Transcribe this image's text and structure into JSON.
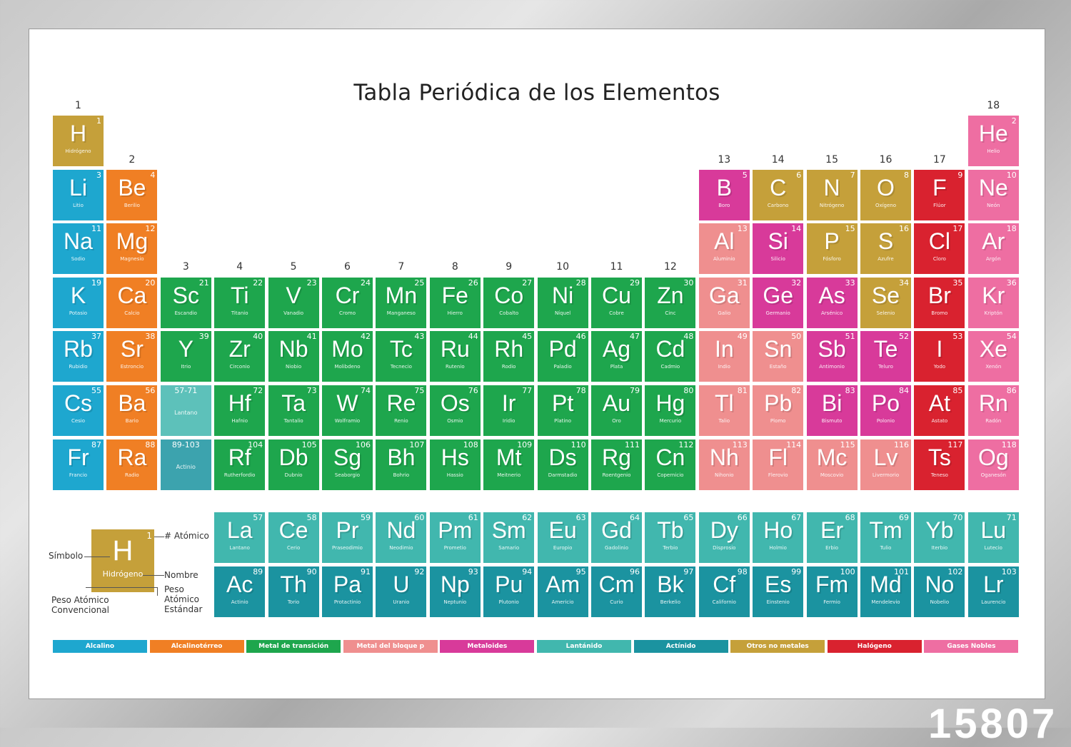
{
  "title": "Tabla Periódica de los Elementos",
  "colors": {
    "alkali": "#1ea7cf",
    "alkaline": "#f07f24",
    "transition": "#1ea64d",
    "post": "#ef8f8f",
    "metalloid": "#d83a9a",
    "lanthanide": "#41b7ae",
    "actinide": "#1b93a0",
    "nonmetal": "#c5a03a",
    "halogen": "#d9222f",
    "noble": "#ee6ea2"
  },
  "group_numbers": [
    "1",
    "2",
    "3",
    "4",
    "5",
    "6",
    "7",
    "8",
    "9",
    "10",
    "11",
    "12",
    "13",
    "14",
    "15",
    "16",
    "17",
    "18"
  ],
  "elements": [
    {
      "n": "1",
      "s": "H",
      "name": "Hidrógeno",
      "c": "nonmetal",
      "g": 1,
      "p": 1
    },
    {
      "n": "2",
      "s": "He",
      "name": "Helio",
      "c": "noble",
      "g": 18,
      "p": 1
    },
    {
      "n": "3",
      "s": "Li",
      "name": "Litio",
      "c": "alkali",
      "g": 1,
      "p": 2
    },
    {
      "n": "4",
      "s": "Be",
      "name": "Berilio",
      "c": "alkaline",
      "g": 2,
      "p": 2
    },
    {
      "n": "5",
      "s": "B",
      "name": "Boro",
      "c": "metalloid",
      "g": 13,
      "p": 2
    },
    {
      "n": "6",
      "s": "C",
      "name": "Carbono",
      "c": "nonmetal",
      "g": 14,
      "p": 2
    },
    {
      "n": "7",
      "s": "N",
      "name": "Nitrógeno",
      "c": "nonmetal",
      "g": 15,
      "p": 2
    },
    {
      "n": "8",
      "s": "O",
      "name": "Oxígeno",
      "c": "nonmetal",
      "g": 16,
      "p": 2
    },
    {
      "n": "9",
      "s": "F",
      "name": "Flúor",
      "c": "halogen",
      "g": 17,
      "p": 2
    },
    {
      "n": "10",
      "s": "Ne",
      "name": "Neón",
      "c": "noble",
      "g": 18,
      "p": 2
    },
    {
      "n": "11",
      "s": "Na",
      "name": "Sodio",
      "c": "alkali",
      "g": 1,
      "p": 3
    },
    {
      "n": "12",
      "s": "Mg",
      "name": "Magnesio",
      "c": "alkaline",
      "g": 2,
      "p": 3
    },
    {
      "n": "13",
      "s": "Al",
      "name": "Aluminio",
      "c": "post",
      "g": 13,
      "p": 3
    },
    {
      "n": "14",
      "s": "Si",
      "name": "Silicio",
      "c": "metalloid",
      "g": 14,
      "p": 3
    },
    {
      "n": "15",
      "s": "P",
      "name": "Fósforo",
      "c": "nonmetal",
      "g": 15,
      "p": 3
    },
    {
      "n": "16",
      "s": "S",
      "name": "Azufre",
      "c": "nonmetal",
      "g": 16,
      "p": 3
    },
    {
      "n": "17",
      "s": "Cl",
      "name": "Cloro",
      "c": "halogen",
      "g": 17,
      "p": 3
    },
    {
      "n": "18",
      "s": "Ar",
      "name": "Argón",
      "c": "noble",
      "g": 18,
      "p": 3
    },
    {
      "n": "19",
      "s": "K",
      "name": "Potasio",
      "c": "alkali",
      "g": 1,
      "p": 4
    },
    {
      "n": "20",
      "s": "Ca",
      "name": "Calcio",
      "c": "alkaline",
      "g": 2,
      "p": 4
    },
    {
      "n": "21",
      "s": "Sc",
      "name": "Escandio",
      "c": "transition",
      "g": 3,
      "p": 4
    },
    {
      "n": "22",
      "s": "Ti",
      "name": "Titanio",
      "c": "transition",
      "g": 4,
      "p": 4
    },
    {
      "n": "23",
      "s": "V",
      "name": "Vanadio",
      "c": "transition",
      "g": 5,
      "p": 4
    },
    {
      "n": "24",
      "s": "Cr",
      "name": "Cromo",
      "c": "transition",
      "g": 6,
      "p": 4
    },
    {
      "n": "25",
      "s": "Mn",
      "name": "Manganeso",
      "c": "transition",
      "g": 7,
      "p": 4
    },
    {
      "n": "26",
      "s": "Fe",
      "name": "Hierro",
      "c": "transition",
      "g": 8,
      "p": 4
    },
    {
      "n": "27",
      "s": "Co",
      "name": "Cobalto",
      "c": "transition",
      "g": 9,
      "p": 4
    },
    {
      "n": "28",
      "s": "Ni",
      "name": "Níquel",
      "c": "transition",
      "g": 10,
      "p": 4
    },
    {
      "n": "29",
      "s": "Cu",
      "name": "Cobre",
      "c": "transition",
      "g": 11,
      "p": 4
    },
    {
      "n": "30",
      "s": "Zn",
      "name": "Cinc",
      "c": "transition",
      "g": 12,
      "p": 4
    },
    {
      "n": "31",
      "s": "Ga",
      "name": "Galio",
      "c": "post",
      "g": 13,
      "p": 4
    },
    {
      "n": "32",
      "s": "Ge",
      "name": "Germanio",
      "c": "metalloid",
      "g": 14,
      "p": 4
    },
    {
      "n": "33",
      "s": "As",
      "name": "Arsénico",
      "c": "metalloid",
      "g": 15,
      "p": 4
    },
    {
      "n": "34",
      "s": "Se",
      "name": "Selenio",
      "c": "nonmetal",
      "g": 16,
      "p": 4
    },
    {
      "n": "35",
      "s": "Br",
      "name": "Bromo",
      "c": "halogen",
      "g": 17,
      "p": 4
    },
    {
      "n": "36",
      "s": "Kr",
      "name": "Kriptón",
      "c": "noble",
      "g": 18,
      "p": 4
    },
    {
      "n": "37",
      "s": "Rb",
      "name": "Rubidio",
      "c": "alkali",
      "g": 1,
      "p": 5
    },
    {
      "n": "38",
      "s": "Sr",
      "name": "Estroncio",
      "c": "alkaline",
      "g": 2,
      "p": 5
    },
    {
      "n": "39",
      "s": "Y",
      "name": "Itrio",
      "c": "transition",
      "g": 3,
      "p": 5
    },
    {
      "n": "40",
      "s": "Zr",
      "name": "Circonio",
      "c": "transition",
      "g": 4,
      "p": 5
    },
    {
      "n": "41",
      "s": "Nb",
      "name": "Niobio",
      "c": "transition",
      "g": 5,
      "p": 5
    },
    {
      "n": "42",
      "s": "Mo",
      "name": "Molibdeno",
      "c": "transition",
      "g": 6,
      "p": 5
    },
    {
      "n": "43",
      "s": "Tc",
      "name": "Tecnecio",
      "c": "transition",
      "g": 7,
      "p": 5
    },
    {
      "n": "44",
      "s": "Ru",
      "name": "Rutenio",
      "c": "transition",
      "g": 8,
      "p": 5
    },
    {
      "n": "45",
      "s": "Rh",
      "name": "Rodio",
      "c": "transition",
      "g": 9,
      "p": 5
    },
    {
      "n": "46",
      "s": "Pd",
      "name": "Paladio",
      "c": "transition",
      "g": 10,
      "p": 5
    },
    {
      "n": "47",
      "s": "Ag",
      "name": "Plata",
      "c": "transition",
      "g": 11,
      "p": 5
    },
    {
      "n": "48",
      "s": "Cd",
      "name": "Cadmio",
      "c": "transition",
      "g": 12,
      "p": 5
    },
    {
      "n": "49",
      "s": "In",
      "name": "Indio",
      "c": "post",
      "g": 13,
      "p": 5
    },
    {
      "n": "50",
      "s": "Sn",
      "name": "Estaño",
      "c": "post",
      "g": 14,
      "p": 5
    },
    {
      "n": "51",
      "s": "Sb",
      "name": "Antimonio",
      "c": "metalloid",
      "g": 15,
      "p": 5
    },
    {
      "n": "52",
      "s": "Te",
      "name": "Teluro",
      "c": "metalloid",
      "g": 16,
      "p": 5
    },
    {
      "n": "53",
      "s": "I",
      "name": "Yodo",
      "c": "halogen",
      "g": 17,
      "p": 5
    },
    {
      "n": "54",
      "s": "Xe",
      "name": "Xenón",
      "c": "noble",
      "g": 18,
      "p": 5
    },
    {
      "n": "55",
      "s": "Cs",
      "name": "Cesio",
      "c": "alkali",
      "g": 1,
      "p": 6
    },
    {
      "n": "56",
      "s": "Ba",
      "name": "Bario",
      "c": "alkaline",
      "g": 2,
      "p": 6
    },
    {
      "n": "57-71",
      "s": "",
      "name": "Lantano",
      "c": "lanthanide",
      "g": 3,
      "p": 6,
      "placeholder": true
    },
    {
      "n": "72",
      "s": "Hf",
      "name": "Hafnio",
      "c": "transition",
      "g": 4,
      "p": 6
    },
    {
      "n": "73",
      "s": "Ta",
      "name": "Tantalio",
      "c": "transition",
      "g": 5,
      "p": 6
    },
    {
      "n": "74",
      "s": "W",
      "name": "Wolframio",
      "c": "transition",
      "g": 6,
      "p": 6
    },
    {
      "n": "75",
      "s": "Re",
      "name": "Renio",
      "c": "transition",
      "g": 7,
      "p": 6
    },
    {
      "n": "76",
      "s": "Os",
      "name": "Osmio",
      "c": "transition",
      "g": 8,
      "p": 6
    },
    {
      "n": "77",
      "s": "Ir",
      "name": "Iridio",
      "c": "transition",
      "g": 9,
      "p": 6
    },
    {
      "n": "78",
      "s": "Pt",
      "name": "Platino",
      "c": "transition",
      "g": 10,
      "p": 6
    },
    {
      "n": "79",
      "s": "Au",
      "name": "Oro",
      "c": "transition",
      "g": 11,
      "p": 6
    },
    {
      "n": "80",
      "s": "Hg",
      "name": "Mercurio",
      "c": "transition",
      "g": 12,
      "p": 6
    },
    {
      "n": "81",
      "s": "Tl",
      "name": "Talio",
      "c": "post",
      "g": 13,
      "p": 6
    },
    {
      "n": "82",
      "s": "Pb",
      "name": "Plomo",
      "c": "post",
      "g": 14,
      "p": 6
    },
    {
      "n": "83",
      "s": "Bi",
      "name": "Bismuto",
      "c": "metalloid",
      "g": 15,
      "p": 6
    },
    {
      "n": "84",
      "s": "Po",
      "name": "Polonio",
      "c": "metalloid",
      "g": 16,
      "p": 6
    },
    {
      "n": "85",
      "s": "At",
      "name": "Astato",
      "c": "halogen",
      "g": 17,
      "p": 6
    },
    {
      "n": "86",
      "s": "Rn",
      "name": "Radón",
      "c": "noble",
      "g": 18,
      "p": 6
    },
    {
      "n": "87",
      "s": "Fr",
      "name": "Francio",
      "c": "alkali",
      "g": 1,
      "p": 7
    },
    {
      "n": "88",
      "s": "Ra",
      "name": "Radio",
      "c": "alkaline",
      "g": 2,
      "p": 7
    },
    {
      "n": "89-103",
      "s": "",
      "name": "Actinio",
      "c": "actinide",
      "g": 3,
      "p": 7,
      "placeholder": true
    },
    {
      "n": "104",
      "s": "Rf",
      "name": "Rutherfordio",
      "c": "transition",
      "g": 4,
      "p": 7
    },
    {
      "n": "105",
      "s": "Db",
      "name": "Dubnio",
      "c": "transition",
      "g": 5,
      "p": 7
    },
    {
      "n": "106",
      "s": "Sg",
      "name": "Seaborgio",
      "c": "transition",
      "g": 6,
      "p": 7
    },
    {
      "n": "107",
      "s": "Bh",
      "name": "Bohrio",
      "c": "transition",
      "g": 7,
      "p": 7
    },
    {
      "n": "108",
      "s": "Hs",
      "name": "Hassio",
      "c": "transition",
      "g": 8,
      "p": 7
    },
    {
      "n": "109",
      "s": "Mt",
      "name": "Meitnerio",
      "c": "transition",
      "g": 9,
      "p": 7
    },
    {
      "n": "110",
      "s": "Ds",
      "name": "Darmstadio",
      "c": "transition",
      "g": 10,
      "p": 7
    },
    {
      "n": "111",
      "s": "Rg",
      "name": "Roentgenio",
      "c": "transition",
      "g": 11,
      "p": 7
    },
    {
      "n": "112",
      "s": "Cn",
      "name": "Copernicio",
      "c": "transition",
      "g": 12,
      "p": 7
    },
    {
      "n": "113",
      "s": "Nh",
      "name": "Nihonio",
      "c": "post",
      "g": 13,
      "p": 7
    },
    {
      "n": "114",
      "s": "Fl",
      "name": "Flerovio",
      "c": "post",
      "g": 14,
      "p": 7
    },
    {
      "n": "115",
      "s": "Mc",
      "name": "Moscovio",
      "c": "post",
      "g": 15,
      "p": 7
    },
    {
      "n": "116",
      "s": "Lv",
      "name": "Livermorio",
      "c": "post",
      "g": 16,
      "p": 7
    },
    {
      "n": "117",
      "s": "Ts",
      "name": "Teneso",
      "c": "halogen",
      "g": 17,
      "p": 7
    },
    {
      "n": "118",
      "s": "Og",
      "name": "Oganesón",
      "c": "noble",
      "g": 18,
      "p": 7
    },
    {
      "n": "57",
      "s": "La",
      "name": "Lantano",
      "c": "lanthanide",
      "g": 4,
      "p": 8
    },
    {
      "n": "58",
      "s": "Ce",
      "name": "Cerio",
      "c": "lanthanide",
      "g": 5,
      "p": 8
    },
    {
      "n": "59",
      "s": "Pr",
      "name": "Praseodimio",
      "c": "lanthanide",
      "g": 6,
      "p": 8
    },
    {
      "n": "60",
      "s": "Nd",
      "name": "Neodimio",
      "c": "lanthanide",
      "g": 7,
      "p": 8
    },
    {
      "n": "61",
      "s": "Pm",
      "name": "Prometio",
      "c": "lanthanide",
      "g": 8,
      "p": 8
    },
    {
      "n": "62",
      "s": "Sm",
      "name": "Samario",
      "c": "lanthanide",
      "g": 9,
      "p": 8
    },
    {
      "n": "63",
      "s": "Eu",
      "name": "Europio",
      "c": "lanthanide",
      "g": 10,
      "p": 8
    },
    {
      "n": "64",
      "s": "Gd",
      "name": "Gadolinio",
      "c": "lanthanide",
      "g": 11,
      "p": 8
    },
    {
      "n": "65",
      "s": "Tb",
      "name": "Terbio",
      "c": "lanthanide",
      "g": 12,
      "p": 8
    },
    {
      "n": "66",
      "s": "Dy",
      "name": "Disprosio",
      "c": "lanthanide",
      "g": 13,
      "p": 8
    },
    {
      "n": "67",
      "s": "Ho",
      "name": "Holmio",
      "c": "lanthanide",
      "g": 14,
      "p": 8
    },
    {
      "n": "68",
      "s": "Er",
      "name": "Erbio",
      "c": "lanthanide",
      "g": 15,
      "p": 8
    },
    {
      "n": "69",
      "s": "Tm",
      "name": "Tulio",
      "c": "lanthanide",
      "g": 16,
      "p": 8
    },
    {
      "n": "70",
      "s": "Yb",
      "name": "Iterbio",
      "c": "lanthanide",
      "g": 17,
      "p": 8
    },
    {
      "n": "71",
      "s": "Lu",
      "name": "Lutecio",
      "c": "lanthanide",
      "g": 18,
      "p": 8
    },
    {
      "n": "89",
      "s": "Ac",
      "name": "Actinio",
      "c": "actinide",
      "g": 4,
      "p": 9
    },
    {
      "n": "90",
      "s": "Th",
      "name": "Torio",
      "c": "actinide",
      "g": 5,
      "p": 9
    },
    {
      "n": "91",
      "s": "Pa",
      "name": "Protactinio",
      "c": "actinide",
      "g": 6,
      "p": 9
    },
    {
      "n": "92",
      "s": "U",
      "name": "Uranio",
      "c": "actinide",
      "g": 7,
      "p": 9
    },
    {
      "n": "93",
      "s": "Np",
      "name": "Neptunio",
      "c": "actinide",
      "g": 8,
      "p": 9
    },
    {
      "n": "94",
      "s": "Pu",
      "name": "Plutonio",
      "c": "actinide",
      "g": 9,
      "p": 9
    },
    {
      "n": "95",
      "s": "Am",
      "name": "Americio",
      "c": "actinide",
      "g": 10,
      "p": 9
    },
    {
      "n": "96",
      "s": "Cm",
      "name": "Curio",
      "c": "actinide",
      "g": 11,
      "p": 9
    },
    {
      "n": "97",
      "s": "Bk",
      "name": "Berkelio",
      "c": "actinide",
      "g": 12,
      "p": 9
    },
    {
      "n": "98",
      "s": "Cf",
      "name": "Californio",
      "c": "actinide",
      "g": 13,
      "p": 9
    },
    {
      "n": "99",
      "s": "Es",
      "name": "Einstenio",
      "c": "actinide",
      "g": 14,
      "p": 9
    },
    {
      "n": "100",
      "s": "Fm",
      "name": "Fermio",
      "c": "actinide",
      "g": 15,
      "p": 9
    },
    {
      "n": "101",
      "s": "Md",
      "name": "Mendelevio",
      "c": "actinide",
      "g": 16,
      "p": 9
    },
    {
      "n": "102",
      "s": "No",
      "name": "Nobelio",
      "c": "actinide",
      "g": 17,
      "p": 9
    },
    {
      "n": "103",
      "s": "Lr",
      "name": "Laurencio",
      "c": "actinide",
      "g": 18,
      "p": 9
    }
  ],
  "key": {
    "number": "1",
    "symbol": "H",
    "name": "Hidrógeno",
    "label_number": "# Atómico",
    "label_symbol": "Símbolo",
    "label_name": "Nombre",
    "label_mass_conv": "Peso Atómico Convencional",
    "label_mass_std": "Peso Atómico Estándar"
  },
  "categories": [
    {
      "label": "Alcalino",
      "c": "alkali"
    },
    {
      "label": "Alcalinotérreo",
      "c": "alkaline"
    },
    {
      "label": "Metal de transición",
      "c": "transition"
    },
    {
      "label": "Metal del bloque p",
      "c": "post"
    },
    {
      "label": "Metaloides",
      "c": "metalloid"
    },
    {
      "label": "Lantánido",
      "c": "lanthanide"
    },
    {
      "label": "Actínido",
      "c": "actinide"
    },
    {
      "label": "Otros no metales",
      "c": "nonmetal"
    },
    {
      "label": "Halógeno",
      "c": "halogen"
    },
    {
      "label": "Gases Nobles",
      "c": "noble"
    }
  ],
  "frame_number": "15807"
}
